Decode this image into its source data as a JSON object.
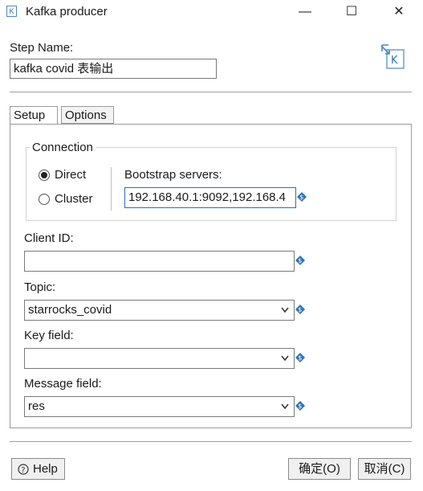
{
  "window": {
    "title": "Kafka producer",
    "app_icon_glyph": "K",
    "minimize_glyph": "—",
    "maximize_glyph": "☐",
    "close_glyph": "✕"
  },
  "step": {
    "label": "Step Name:",
    "value": "kafka  covid 表输出",
    "icon": "kafka-producer-icon"
  },
  "tabs": [
    {
      "label": "Setup",
      "active": true
    },
    {
      "label": "Options",
      "active": false
    }
  ],
  "connection": {
    "legend": "Connection",
    "options": [
      {
        "label": "Direct",
        "selected": true
      },
      {
        "label": "Cluster",
        "selected": false
      }
    ],
    "bootstrap_label": "Bootstrap servers:",
    "bootstrap_value": "192.168.40.1:9092,192.168.4"
  },
  "client_id": {
    "label": "Client ID:",
    "value": ""
  },
  "topic": {
    "label": "Topic:",
    "value": "starrocks_covid"
  },
  "key_field": {
    "label": "Key field:",
    "value": ""
  },
  "message_field": {
    "label": "Message field:",
    "value": "res"
  },
  "buttons": {
    "help": "Help",
    "ok": "确定(O)",
    "cancel": "取消(C)"
  },
  "colors": {
    "accent": "#2b6cc4",
    "variable_icon": "#2e75b6"
  }
}
